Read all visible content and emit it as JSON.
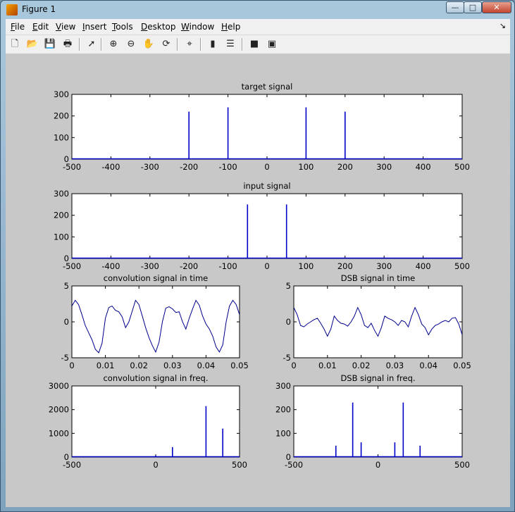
{
  "window": {
    "title": "Figure 1",
    "minimize": "—",
    "maximize": "□",
    "close": "✕",
    "dock": "↘"
  },
  "menu": [
    {
      "key": "F",
      "rest": "ile"
    },
    {
      "key": "E",
      "rest": "dit"
    },
    {
      "key": "V",
      "rest": "iew"
    },
    {
      "key": "I",
      "rest": "nsert"
    },
    {
      "key": "T",
      "rest": "ools"
    },
    {
      "key": "D",
      "rest": "esktop"
    },
    {
      "key": "W",
      "rest": "indow"
    },
    {
      "key": "H",
      "rest": "elp"
    }
  ],
  "toolbar": [
    {
      "name": "new-figure-icon",
      "glyph": "🗋"
    },
    {
      "name": "open-file-icon",
      "glyph": "📂"
    },
    {
      "name": "save-icon",
      "glyph": "💾"
    },
    {
      "name": "print-icon",
      "glyph": "🖶"
    },
    {
      "name": "edit-plot-arrow-icon",
      "glyph": "➚"
    },
    {
      "name": "zoom-in-icon",
      "glyph": "⊕"
    },
    {
      "name": "zoom-out-icon",
      "glyph": "⊖"
    },
    {
      "name": "pan-hand-icon",
      "glyph": "✋"
    },
    {
      "name": "rotate-3d-icon",
      "glyph": "⟳"
    },
    {
      "name": "data-cursor-icon",
      "glyph": "⌖"
    },
    {
      "name": "colorbar-icon",
      "glyph": "▮"
    },
    {
      "name": "legend-icon",
      "glyph": "☰"
    },
    {
      "name": "hide-plot-tools-icon",
      "glyph": "■"
    },
    {
      "name": "show-plot-tools-icon",
      "glyph": "▣"
    }
  ],
  "chart_data": [
    {
      "type": "bar",
      "title": "target signal",
      "xlim": [
        -500,
        500
      ],
      "ylim": [
        0,
        300
      ],
      "xticks": [
        "-500",
        "-400",
        "-300",
        "-200",
        "-100",
        "0",
        "100",
        "200",
        "300",
        "400",
        "500"
      ],
      "yticks": [
        "0",
        "100",
        "200",
        "300"
      ],
      "x": [
        -200,
        -100,
        100,
        200
      ],
      "values": [
        220,
        240,
        240,
        220
      ],
      "color": "#0000c8"
    },
    {
      "type": "bar",
      "title": "input signal",
      "xlim": [
        -500,
        500
      ],
      "ylim": [
        0,
        300
      ],
      "xticks": [
        "-500",
        "-400",
        "-300",
        "-200",
        "-100",
        "0",
        "100",
        "200",
        "300",
        "400",
        "500"
      ],
      "yticks": [
        "0",
        "100",
        "200",
        "300"
      ],
      "x": [
        -50,
        50
      ],
      "values": [
        250,
        250
      ],
      "color": "#0000c8"
    },
    {
      "type": "line",
      "title": "convolution signal in time",
      "xlim": [
        0,
        0.05
      ],
      "ylim": [
        -5,
        5
      ],
      "xticks": [
        "0",
        "0.01",
        "0.02",
        "0.03",
        "0.04",
        "0.05"
      ],
      "yticks": [
        "-5",
        "0",
        "5"
      ],
      "x": [
        0,
        0.001,
        0.002,
        0.003,
        0.004,
        0.005,
        0.006,
        0.007,
        0.008,
        0.009,
        0.01,
        0.011,
        0.012,
        0.013,
        0.014,
        0.015,
        0.016,
        0.017,
        0.018,
        0.019,
        0.02,
        0.021,
        0.022,
        0.023,
        0.024,
        0.025,
        0.026,
        0.027,
        0.028,
        0.029,
        0.03,
        0.031,
        0.032,
        0.033,
        0.034,
        0.035,
        0.036,
        0.037,
        0.038,
        0.039,
        0.04,
        0.041,
        0.042,
        0.043,
        0.044,
        0.045,
        0.046,
        0.047,
        0.048,
        0.049,
        0.05
      ],
      "values": [
        2.2,
        3.0,
        2.4,
        1.0,
        -0.5,
        -1.5,
        -2.5,
        -3.8,
        -4.3,
        -3.0,
        0.5,
        2.0,
        2.2,
        1.6,
        1.4,
        0.7,
        -0.8,
        0.0,
        1.5,
        3.0,
        2.4,
        0.8,
        -0.8,
        -2.2,
        -3.3,
        -4.2,
        -2.8,
        0.0,
        1.9,
        2.1,
        1.8,
        1.3,
        1.4,
        0.0,
        -1.0,
        0.5,
        1.8,
        3.0,
        2.3,
        0.8,
        -0.3,
        -1.0,
        -2.0,
        -3.5,
        -4.2,
        -3.2,
        0.0,
        2.2,
        3.0,
        2.4,
        1.0
      ],
      "color": "#00008c"
    },
    {
      "type": "line",
      "title": "DSB signal in time",
      "xlim": [
        0,
        0.05
      ],
      "ylim": [
        -5,
        5
      ],
      "xticks": [
        "0",
        "0.01",
        "0.02",
        "0.03",
        "0.04",
        "0.05"
      ],
      "yticks": [
        "-5",
        "0",
        "5"
      ],
      "x": [
        0,
        0.001,
        0.002,
        0.003,
        0.004,
        0.005,
        0.006,
        0.007,
        0.008,
        0.009,
        0.01,
        0.011,
        0.012,
        0.013,
        0.014,
        0.015,
        0.016,
        0.017,
        0.018,
        0.019,
        0.02,
        0.021,
        0.022,
        0.023,
        0.024,
        0.025,
        0.026,
        0.027,
        0.028,
        0.029,
        0.03,
        0.031,
        0.032,
        0.033,
        0.034,
        0.035,
        0.036,
        0.037,
        0.038,
        0.039,
        0.04,
        0.041,
        0.042,
        0.043,
        0.044,
        0.045,
        0.046,
        0.047,
        0.048,
        0.049,
        0.05
      ],
      "values": [
        2.0,
        1.0,
        -0.5,
        -0.7,
        -0.3,
        0.0,
        0.3,
        0.5,
        -0.2,
        -1.0,
        -2.0,
        -1.0,
        0.8,
        0.2,
        -0.2,
        -0.3,
        -0.6,
        0.0,
        0.8,
        2.0,
        1.0,
        -0.5,
        -0.8,
        -0.2,
        -1.2,
        -2.0,
        -0.8,
        0.8,
        0.5,
        0.3,
        0.0,
        -0.5,
        0.2,
        0.0,
        -0.7,
        0.8,
        2.0,
        1.0,
        -0.3,
        -0.8,
        -1.8,
        -1.0,
        -0.5,
        -0.3,
        0.0,
        0.2,
        0.0,
        0.5,
        0.6,
        -0.3,
        -1.8
      ],
      "color": "#00008c"
    },
    {
      "type": "bar",
      "title": "convolution signal in freq.",
      "xlim": [
        -500,
        500
      ],
      "ylim": [
        0,
        3000
      ],
      "xticks": [
        "-500",
        "0",
        "500"
      ],
      "yticks": [
        "0",
        "1000",
        "2000",
        "3000"
      ],
      "x": [
        0,
        100,
        300,
        400
      ],
      "values": [
        60,
        420,
        2150,
        1200
      ],
      "color": "#0000c8"
    },
    {
      "type": "bar",
      "title": "DSB signal in freq.",
      "xlim": [
        -500,
        500
      ],
      "ylim": [
        0,
        300
      ],
      "xticks": [
        "-500",
        "0",
        "500"
      ],
      "yticks": [
        "0",
        "100",
        "200",
        "300"
      ],
      "x": [
        -250,
        -150,
        -100,
        0,
        100,
        150,
        250
      ],
      "values": [
        48,
        230,
        62,
        5,
        62,
        230,
        48
      ],
      "color": "#0000c8"
    }
  ]
}
